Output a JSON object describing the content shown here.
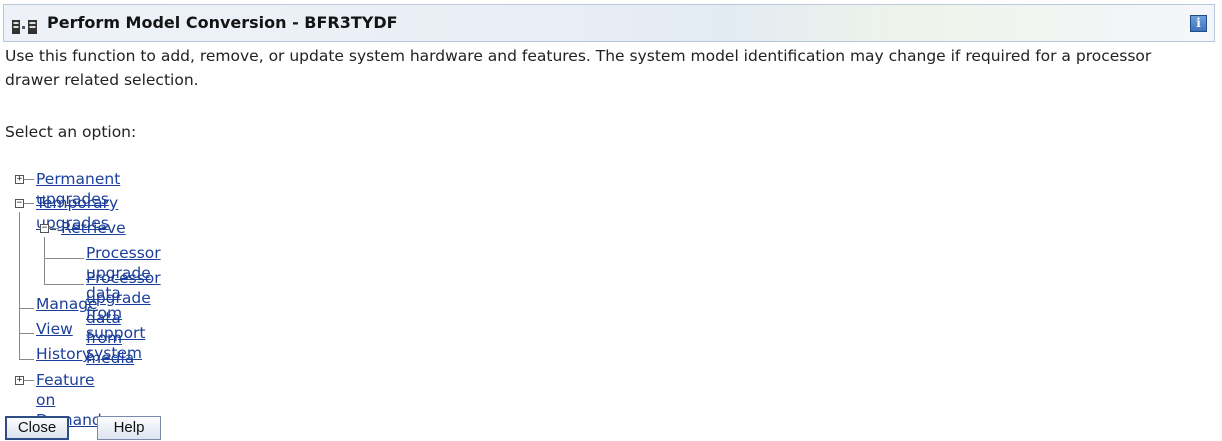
{
  "window": {
    "title": "Perform Model Conversion - BFR3TYDF",
    "info_icon": "i"
  },
  "description": "Use this function to add, remove, or update system hardware and features. The system model identification may change if required for a processor drawer related selection.",
  "prompt": "Select an option:",
  "tree": {
    "permanent_upgrades": "Permanent upgrades",
    "temporary_upgrades": "Temporary upgrades",
    "retrieve": "Retrieve",
    "from_support_system": "Processor upgrade data from support system",
    "from_media": "Processor upgrade data from media",
    "manage": "Manage",
    "view": "View",
    "history": "History",
    "feature_on_demand": "Feature on Demand"
  },
  "buttons": {
    "close": "Close",
    "help": "Help"
  }
}
